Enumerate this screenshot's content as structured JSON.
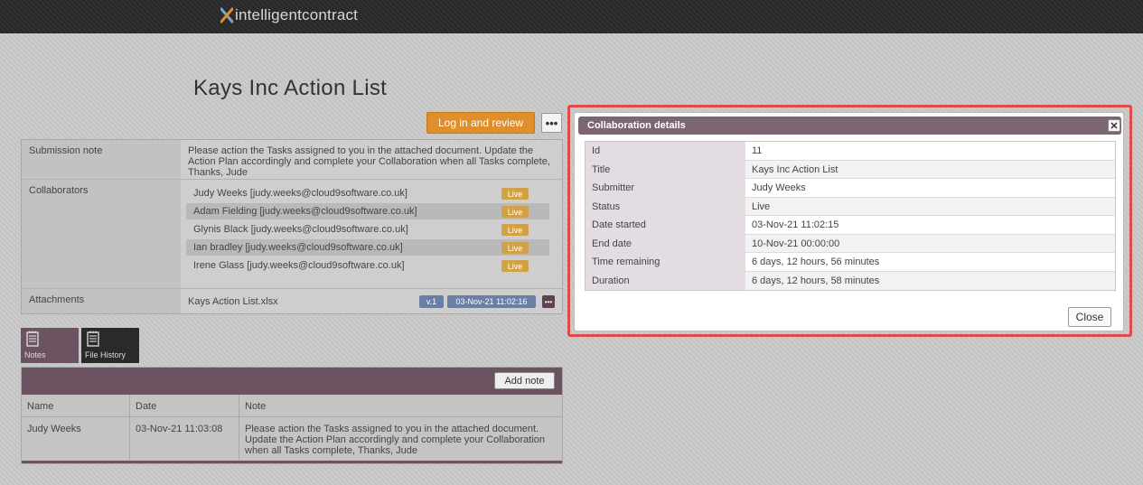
{
  "header": {
    "logo_text": "intelligentcontract"
  },
  "page": {
    "title": "Kays Inc Action List",
    "login_button": "Log in and review",
    "more_button": "•••"
  },
  "details": {
    "submission_note_label": "Submission note",
    "submission_note": "Please action the Tasks assigned to you in the attached document. Update the Action Plan accordingly and complete your Collaboration when all Tasks complete, Thanks, Jude",
    "collaborators_label": "Collaborators",
    "collaborators": [
      {
        "name": "Judy Weeks [judy.weeks@cloud9software.co.uk]",
        "status": "Live"
      },
      {
        "name": "Adam Fielding [judy.weeks@cloud9software.co.uk]",
        "status": "Live"
      },
      {
        "name": "Glynis Black [judy.weeks@cloud9software.co.uk]",
        "status": "Live"
      },
      {
        "name": "Ian bradley [judy.weeks@cloud9software.co.uk]",
        "status": "Live"
      },
      {
        "name": "Irene Glass [judy.weeks@cloud9software.co.uk]",
        "status": "Live"
      }
    ],
    "attachments_label": "Attachments",
    "attachment": {
      "file_name": "Kays Action List.xlsx",
      "version": "v.1",
      "date": "03-Nov-21 11:02:16"
    }
  },
  "tabs": [
    {
      "label": "Notes",
      "icon": "notes-icon"
    },
    {
      "label": "File History",
      "icon": "file-history-icon"
    }
  ],
  "notes": {
    "add_button": "Add note",
    "columns": [
      "Name",
      "Date",
      "Note"
    ],
    "rows": [
      {
        "name": "Judy Weeks",
        "date": "03-Nov-21 11:03:08",
        "note": "Please action the Tasks assigned to you in the attached document. Update the Action Plan accordingly and complete your Collaboration when all Tasks complete, Thanks, Jude"
      }
    ]
  },
  "modal": {
    "title": "Collaboration details",
    "close_x": "✕",
    "rows": [
      {
        "key": "Id",
        "value": "11"
      },
      {
        "key": "Title",
        "value": "Kays Inc Action List"
      },
      {
        "key": "Submitter",
        "value": "Judy Weeks"
      },
      {
        "key": "Status",
        "value": "Live"
      },
      {
        "key": "Date started",
        "value": "03-Nov-21 11:02:15"
      },
      {
        "key": "End date",
        "value": "10-Nov-21 00:00:00"
      },
      {
        "key": "Time remaining",
        "value": "6 days, 12 hours, 56 minutes"
      },
      {
        "key": "Duration",
        "value": "6 days, 12 hours, 58 minutes"
      }
    ],
    "close_button": "Close"
  },
  "colors": {
    "accent_orange": "#e08e2b",
    "brand_mauve": "#7c6573",
    "highlight_red": "#e14a4a",
    "badge_blue": "#6a7fa6",
    "live_badge": "#d1a14a"
  }
}
